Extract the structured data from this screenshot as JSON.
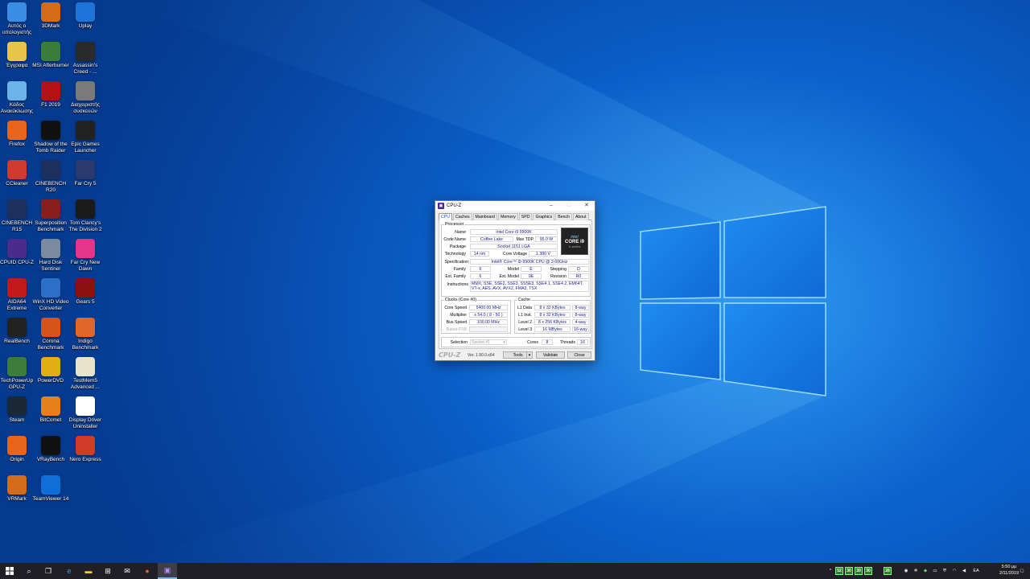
{
  "desktop_icons": [
    {
      "label": "Αυτός ο υπολογιστής",
      "icon": "computer-icon",
      "color": "#3a8ee6"
    },
    {
      "label": "3DMark",
      "icon": "3dmark-icon",
      "color": "#d26b1a"
    },
    {
      "label": "Uplay",
      "icon": "uplay-icon",
      "color": "#1e73d8"
    },
    {
      "label": "Έγγραφα",
      "icon": "documents-icon",
      "color": "#e8c44a"
    },
    {
      "label": "MSI Afterburner",
      "icon": "msi-afterburner-icon",
      "color": "#3a7d3a"
    },
    {
      "label": "Assassin's Creed - ...",
      "icon": "assassins-creed-icon",
      "color": "#2a2a2a"
    },
    {
      "label": "Κάδος Ανακύκλωσης",
      "icon": "recycle-bin-icon",
      "color": "#6bb4ea"
    },
    {
      "label": "F1 2019",
      "icon": "f1-2019-icon",
      "color": "#b31212"
    },
    {
      "label": "Διαχειριστής συσκευών",
      "icon": "device-manager-icon",
      "color": "#7a7a7a"
    },
    {
      "label": "Firefox",
      "icon": "firefox-icon",
      "color": "#e8631c"
    },
    {
      "label": "Shadow of the Tomb Raider",
      "icon": "tomb-raider-icon",
      "color": "#111111"
    },
    {
      "label": "Epic Games Launcher",
      "icon": "epic-games-icon",
      "color": "#222222"
    },
    {
      "label": "CCleaner",
      "icon": "ccleaner-icon",
      "color": "#cf3b2e"
    },
    {
      "label": "CINEBENCH R20",
      "icon": "cinebench-r20-icon",
      "color": "#1d2f5c"
    },
    {
      "label": "Far Cry 5",
      "icon": "far-cry-5-icon",
      "color": "#2b3a6e"
    },
    {
      "label": "CINEBENCH R15",
      "icon": "cinebench-r15-icon",
      "color": "#1d2f5c"
    },
    {
      "label": "Superposition Benchmark",
      "icon": "superposition-icon",
      "color": "#8a1e1e"
    },
    {
      "label": "Tom Clancy's The Division 2",
      "icon": "division-2-icon",
      "color": "#1a1a1a"
    },
    {
      "label": "CPUID CPU-Z",
      "icon": "cpuz-icon",
      "color": "#4b2b8c"
    },
    {
      "label": "Hard Disk Sentinel",
      "icon": "hard-disk-sentinel-icon",
      "color": "#7a8aa0"
    },
    {
      "label": "Far Cry New Dawn",
      "icon": "far-cry-new-dawn-icon",
      "color": "#e4348c"
    },
    {
      "label": "AIDA64 Extreme",
      "icon": "aida64-icon",
      "color": "#c21a1a"
    },
    {
      "label": "WinX HD Video Converter",
      "icon": "winx-video-icon",
      "color": "#2b6fc9"
    },
    {
      "label": "Gears 5",
      "icon": "gears-5-icon",
      "color": "#8c1010"
    },
    {
      "label": "RealBench",
      "icon": "realbench-icon",
      "color": "#222222"
    },
    {
      "label": "Corona Benchmark",
      "icon": "corona-benchmark-icon",
      "color": "#d6541c"
    },
    {
      "label": "Indigo Benchmark",
      "icon": "indigo-benchmark-icon",
      "color": "#e0662a"
    },
    {
      "label": "TechPowerUp GPU-Z",
      "icon": "gpu-z-icon",
      "color": "#3c7d3c"
    },
    {
      "label": "PowerDVD",
      "icon": "powerdvd-icon",
      "color": "#e0b012"
    },
    {
      "label": "TestMem5 Advanced ...",
      "icon": "testmem5-icon",
      "color": "#e8e4cc"
    },
    {
      "label": "Steam",
      "icon": "steam-icon",
      "color": "#1b2838"
    },
    {
      "label": "BitComet",
      "icon": "bitcomet-icon",
      "color": "#e6801a"
    },
    {
      "label": "Display Driver Uninstaller",
      "icon": "ddu-icon",
      "color": "#ffffff"
    },
    {
      "label": "Origin",
      "icon": "origin-icon",
      "color": "#e8641c"
    },
    {
      "label": "VRayBench",
      "icon": "vraybench-icon",
      "color": "#111111"
    },
    {
      "label": "Nero Express",
      "icon": "nero-express-icon",
      "color": "#d23a2a"
    },
    {
      "label": "VRMark",
      "icon": "vrmark-icon",
      "color": "#d26b1a"
    },
    {
      "label": "TeamViewer 14",
      "icon": "teamviewer-icon",
      "color": "#0e6fd8"
    }
  ],
  "cpuz": {
    "title": "CPU-Z",
    "controls": {
      "minimize": "–",
      "maximize": "□",
      "close": "✕"
    },
    "tabs": [
      "CPU",
      "Caches",
      "Mainboard",
      "Memory",
      "SPD",
      "Graphics",
      "Bench",
      "About"
    ],
    "processor": {
      "group": "Processor",
      "name_label": "Name",
      "name": "Intel Core i9 9900K",
      "codename_label": "Code Name",
      "codename": "Coffee Lake",
      "maxtdp_label": "Max TDP",
      "maxtdp": "95.0 W",
      "package_label": "Package",
      "package": "Socket 1151 LGA",
      "technology_label": "Technology",
      "technology": "14 nm",
      "corevoltage_label": "Core Voltage",
      "corevoltage": "1.380 V",
      "spec_label": "Specification",
      "spec": "Intel® Core™ i9-9900K CPU @ 3.60GHz",
      "family_label": "Family",
      "family": "6",
      "model_label": "Model",
      "model": "E",
      "stepping_label": "Stepping",
      "stepping": "D",
      "extfamily_label": "Ext. Family",
      "extfamily": "6",
      "extmodel_label": "Ext. Model",
      "extmodel": "9E",
      "revision_label": "Revision",
      "revision": "R0",
      "instructions_label": "Instructions",
      "instructions": "MMX, SSE, SSE2, SSE3, SSSE3, SSE4.1, SSE4.2, EM64T, VT-x, AES, AVX, AVX2, FMA3, TSX",
      "logo": {
        "brand": "intel",
        "line": "CORE i9",
        "sub": "X-series"
      }
    },
    "clocks": {
      "group": "Clocks (Core #0)",
      "corespeed_label": "Core Speed",
      "corespeed": "5400.00 MHz",
      "multiplier_label": "Multiplier",
      "multiplier": "x 54.0 ( 8 - 50 )",
      "busspeed_label": "Bus Speed",
      "busspeed": "100.00 MHz",
      "ratedfsb_label": "Rated FSB",
      "ratedfsb": ""
    },
    "cache": {
      "group": "Cache",
      "l1data_label": "L1 Data",
      "l1data": "8 x 32 KBytes",
      "l1data_way": "8-way",
      "l1inst_label": "L1 Inst.",
      "l1inst": "8 x 32 KBytes",
      "l1inst_way": "8-way",
      "l2_label": "Level 2",
      "l2": "8 x 256 KBytes",
      "l2_way": "4-way",
      "l3_label": "Level 3",
      "l3": "16 MBytes",
      "l3_way": "16-way"
    },
    "selection_label": "Selection",
    "selection": "Socket #1",
    "cores_label": "Cores",
    "cores": "8",
    "threads_label": "Threads",
    "threads": "16",
    "brand": "CPU-Z",
    "version": "Ver. 1.90.0.x64",
    "tools_label": "Tools",
    "validate_label": "Validate",
    "close_label": "Close"
  },
  "taskbar": {
    "tray_numbers": [
      "52",
      "30",
      "30",
      "30",
      "28"
    ],
    "language": "EA",
    "time": "5:50 μμ",
    "date": "2/11/2019"
  }
}
